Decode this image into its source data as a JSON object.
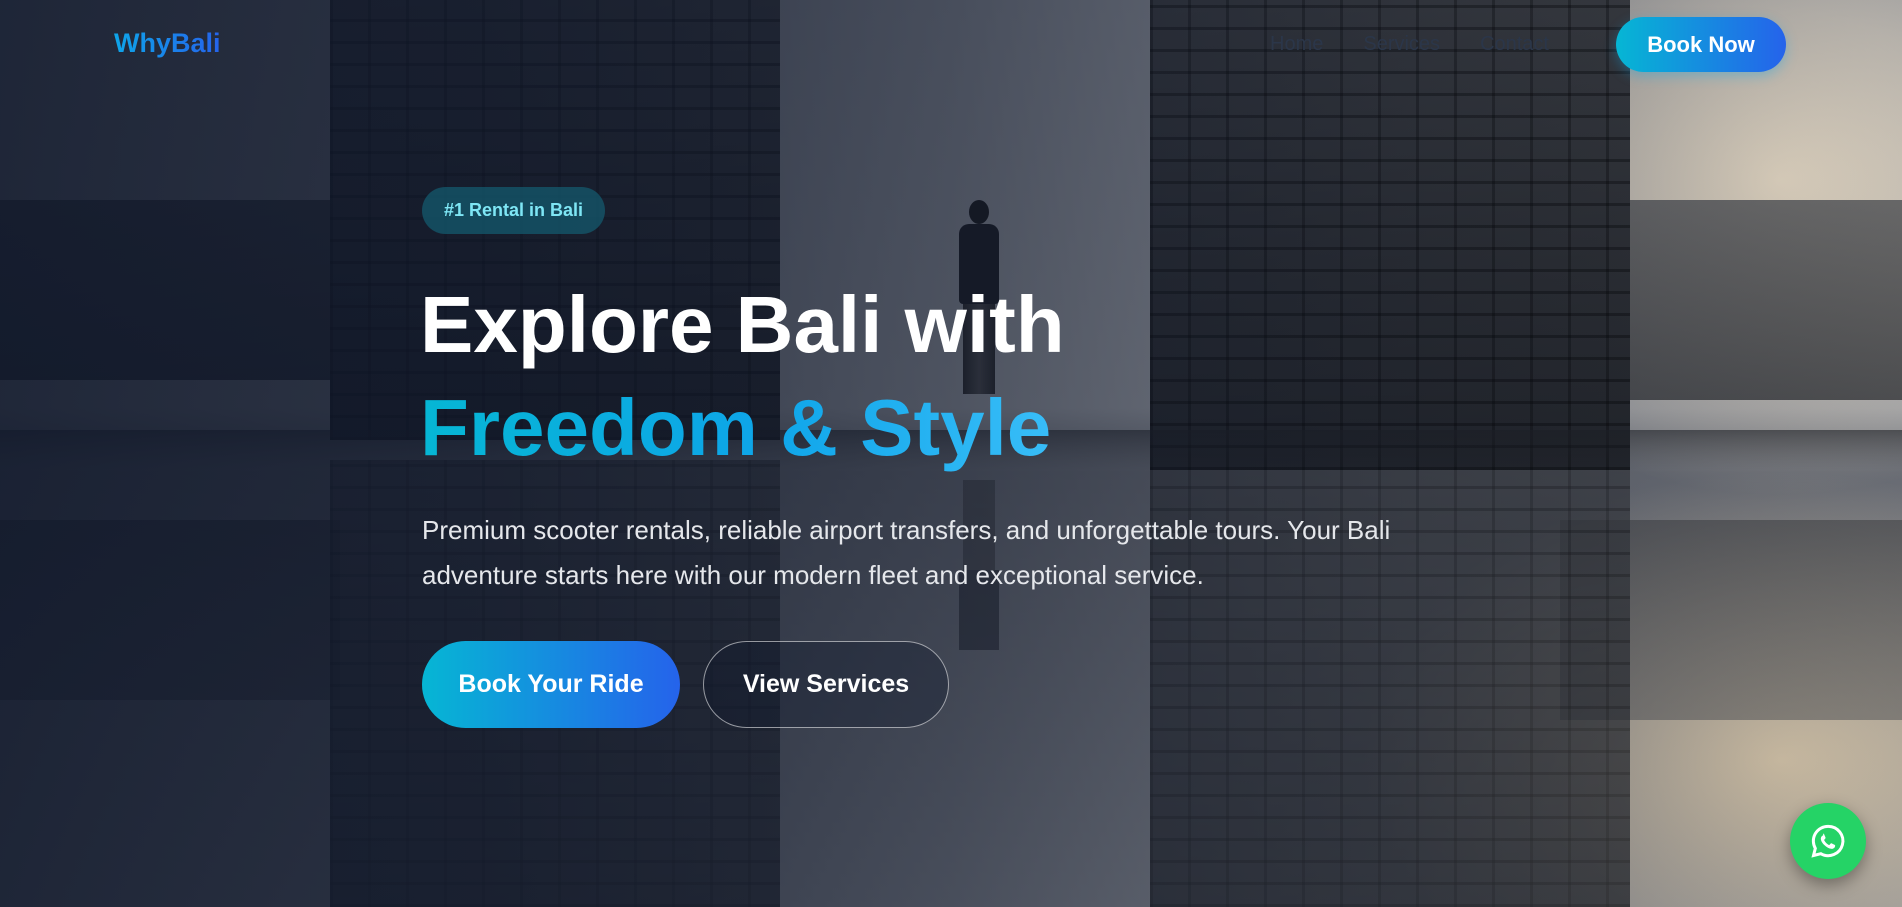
{
  "nav": {
    "logo": "WhyBali",
    "links": [
      {
        "label": "Home"
      },
      {
        "label": "Services"
      },
      {
        "label": "Contact"
      }
    ],
    "cta": "Book Now"
  },
  "hero": {
    "badge": "#1 Rental in Bali",
    "title_line1": "Explore Bali with",
    "title_line2": "Freedom & Style",
    "subtitle": "Premium scooter rentals, reliable airport transfers, and unforgettable tours. Your Bali adventure starts here with our modern fleet and exceptional service.",
    "primary_button": "Book Your Ride",
    "secondary_button": "View Services"
  },
  "floating": {
    "whatsapp_icon": "whatsapp-icon"
  },
  "colors": {
    "accent_cyan": "#06b6d4",
    "accent_blue": "#2563eb",
    "whatsapp_green": "#25d366"
  }
}
